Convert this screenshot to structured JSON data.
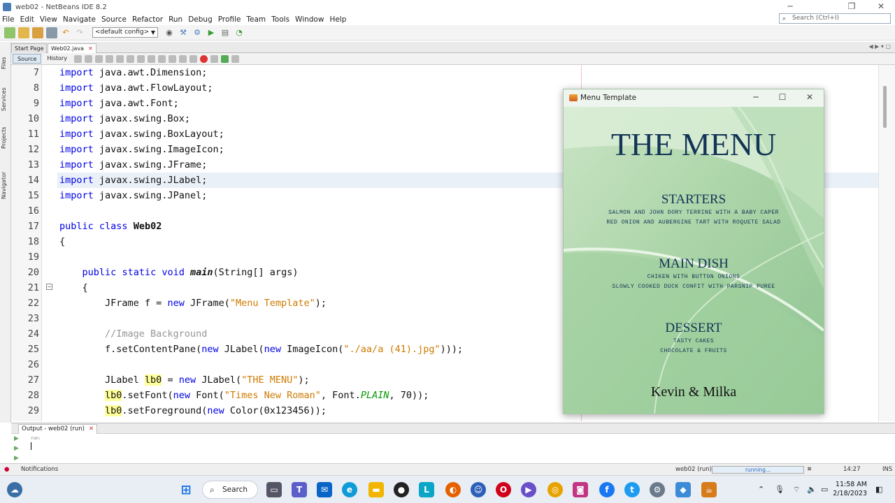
{
  "window": {
    "title": "web02 - NetBeans IDE 8.2",
    "minimize": "─",
    "maximize": "❐",
    "close": "✕"
  },
  "menu": [
    "File",
    "Edit",
    "View",
    "Navigate",
    "Source",
    "Refactor",
    "Run",
    "Debug",
    "Profile",
    "Team",
    "Tools",
    "Window",
    "Help"
  ],
  "search": {
    "placeholder": "Search (Ctrl+I)"
  },
  "toolbar": {
    "config": "<default config>"
  },
  "left_tabs": [
    "Files",
    "Services",
    "Projects",
    "Navigator"
  ],
  "editor_tabs": [
    {
      "label": "Start Page",
      "active": false
    },
    {
      "label": "Web02.java",
      "active": true
    }
  ],
  "editor_toolbar": {
    "source": "Source",
    "history": "History"
  },
  "code": {
    "lines": [
      {
        "n": "7",
        "text": "import java.awt.Dimension;"
      },
      {
        "n": "8",
        "text": "import java.awt.FlowLayout;"
      },
      {
        "n": "9",
        "text": "import java.awt.Font;"
      },
      {
        "n": "10",
        "text": "import javax.swing.Box;"
      },
      {
        "n": "11",
        "text": "import javax.swing.BoxLayout;"
      },
      {
        "n": "12",
        "text": "import javax.swing.ImageIcon;"
      },
      {
        "n": "13",
        "text": "import javax.swing.JFrame;"
      },
      {
        "n": "14",
        "text": "import javax.swing.JLabel;"
      },
      {
        "n": "15",
        "text": "import javax.swing.JPanel;"
      },
      {
        "n": "16",
        "text": ""
      },
      {
        "n": "17",
        "text": "public class Web02"
      },
      {
        "n": "18",
        "text": "{"
      },
      {
        "n": "19",
        "text": ""
      },
      {
        "n": "20",
        "text": "    public static void main(String[] args)"
      },
      {
        "n": "21",
        "text": "    {"
      },
      {
        "n": "22",
        "text": "        JFrame f = new JFrame(\"Menu Template\");"
      },
      {
        "n": "23",
        "text": ""
      },
      {
        "n": "24",
        "text": "        //Image Background"
      },
      {
        "n": "25",
        "text": "        f.setContentPane(new JLabel(new ImageIcon(\"./aa/a (41).jpg\")));"
      },
      {
        "n": "26",
        "text": ""
      },
      {
        "n": "27",
        "text": "        JLabel lb0 = new JLabel(\"THE MENU\");"
      },
      {
        "n": "28",
        "text": "        lb0.setFont(new Font(\"Times New Roman\", Font.PLAIN, 70));"
      },
      {
        "n": "29",
        "text": "        lb0.setForeground(new Color(0x123456));"
      }
    ]
  },
  "output": {
    "tab": "Output - web02 (run)",
    "run_text": "run:"
  },
  "status": {
    "notifications": "Notifications",
    "project": "web02 (run)",
    "progress": "running...",
    "position": "14:27",
    "mode": "INS"
  },
  "menu_window": {
    "title": "Menu Template",
    "heading": "THE MENU",
    "sections": [
      {
        "name": "STARTERS",
        "items": [
          "SALMON AND JOHN DORY TERRINE WITH A BABY CAPER",
          "RED ONION AND AUBERGINE TART WITH ROQUETE SALAD"
        ]
      },
      {
        "name": "MAIN DISH",
        "items": [
          "CHIKEN WITH BUTTON ONIONS",
          "SLOWLY COOKED DUCK CONFIT WITH PARSNIP PUREE"
        ]
      },
      {
        "name": "DESSERT",
        "items": [
          "TASTY CAKES",
          "CHOCOLATE & FRUITS"
        ]
      }
    ],
    "footer": "Kevin & Milka",
    "text_color": "#123456"
  },
  "taskbar": {
    "search": "Search",
    "time": "11:58 AM",
    "date": "2/18/2023"
  }
}
